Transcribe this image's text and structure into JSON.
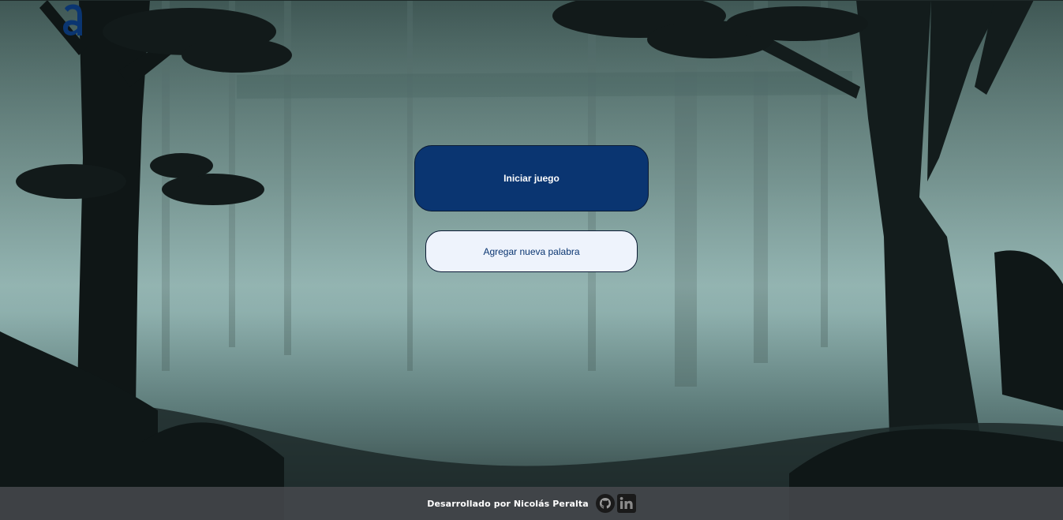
{
  "logo": {
    "letter": "a",
    "color": "#0a3571"
  },
  "buttons": {
    "start_label": "Iniciar juego",
    "add_word_label": "Agregar nueva palabra"
  },
  "footer": {
    "credit": "Desarrollado por Nicolás Peralta",
    "icons": [
      "github-icon",
      "linkedin-icon"
    ]
  },
  "colors": {
    "primary": "#0a3571",
    "secondary_bg": "#eef3fc",
    "footer_bg": "#46484c"
  }
}
